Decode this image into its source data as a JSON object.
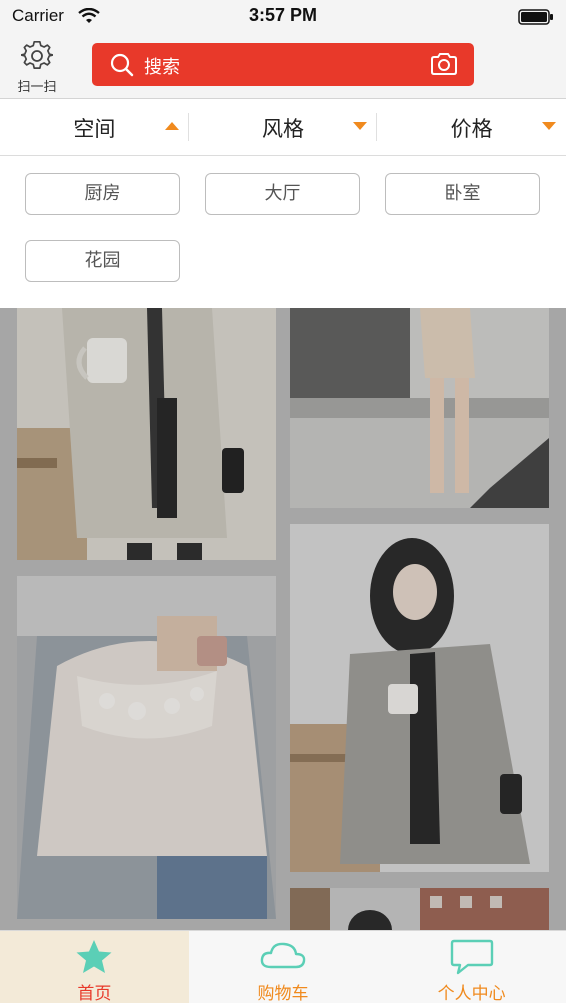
{
  "status_bar": {
    "carrier": "Carrier",
    "time": "3:57 PM"
  },
  "header": {
    "scan_label": "扫一扫",
    "search_placeholder": "搜索",
    "search_color": "#e8392a"
  },
  "filters": [
    {
      "label": "空间",
      "arrow": "up"
    },
    {
      "label": "风格",
      "arrow": "down"
    },
    {
      "label": "价格",
      "arrow": "down"
    }
  ],
  "options": [
    "厨房",
    "大厅",
    "卧室",
    "花园"
  ],
  "products": [
    {
      "name": "knit-cardigan-with-mug"
    },
    {
      "name": "beige-lace-dress-legs"
    },
    {
      "name": "lace-off-shoulder-blouse"
    },
    {
      "name": "gray-coat-woman-with-mug"
    },
    {
      "name": "partial-product-image"
    }
  ],
  "tab_bar": {
    "items": [
      {
        "label": "首页",
        "icon": "star-icon",
        "active": true
      },
      {
        "label": "购物车",
        "icon": "cloud-icon",
        "active": false
      },
      {
        "label": "个人中心",
        "icon": "chat-bubble-icon",
        "active": false
      }
    ],
    "accent_color": "#f08a1e",
    "icon_color": "#5bcfb6"
  }
}
